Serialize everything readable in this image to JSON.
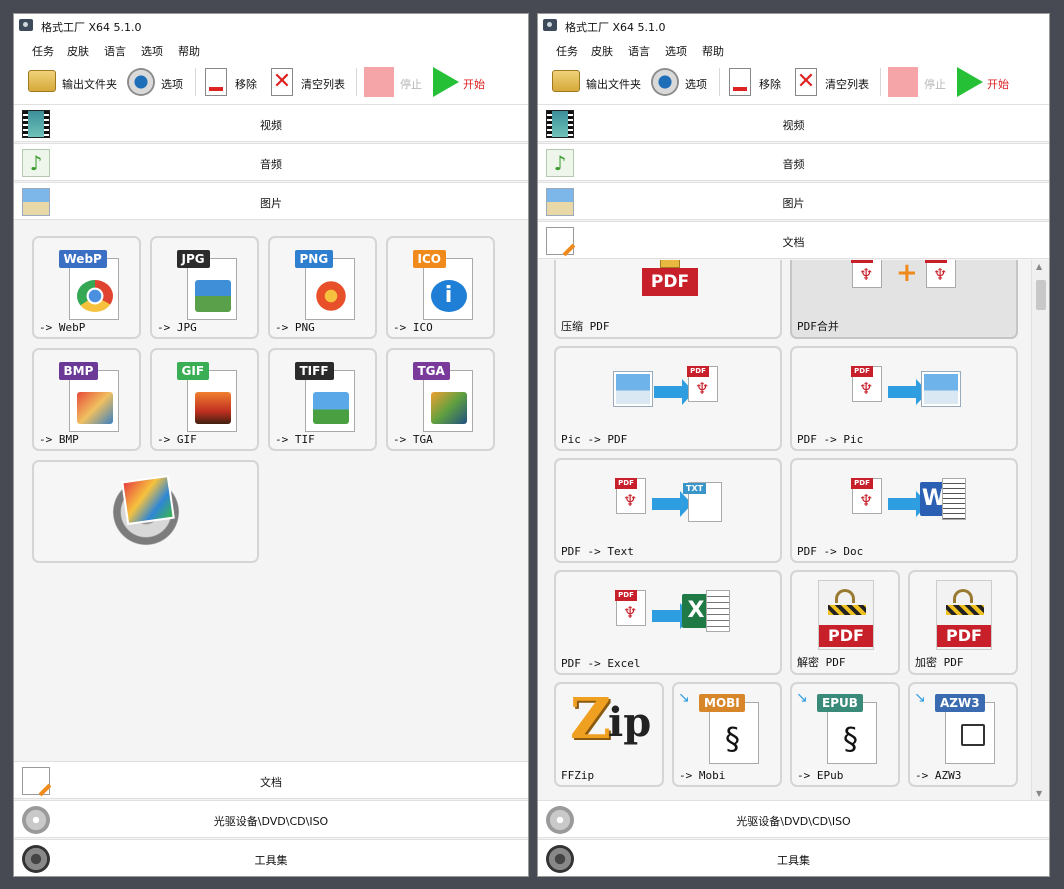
{
  "app": {
    "title": "格式工厂 X64 5.1.0"
  },
  "menu": [
    "任务",
    "皮肤",
    "语言",
    "选项",
    "帮助"
  ],
  "toolbar": {
    "output_folder": "输出文件夹",
    "options": "选项",
    "remove": "移除",
    "clear_list": "清空列表",
    "stop": "停止",
    "start": "开始"
  },
  "categories": {
    "video": "视频",
    "audio": "音频",
    "image": "图片",
    "document": "文档",
    "disc": "光驱设备\\DVD\\CD\\ISO",
    "tools": "工具集"
  },
  "image_formats": [
    {
      "tag": "WebP",
      "label": "-> WebP",
      "color": "#3b6fc4"
    },
    {
      "tag": "JPG",
      "label": "-> JPG",
      "color": "#2b2b2b"
    },
    {
      "tag": "PNG",
      "label": "-> PNG",
      "color": "#2f7fd0"
    },
    {
      "tag": "ICO",
      "label": "-> ICO",
      "color": "#f08a1c"
    },
    {
      "tag": "BMP",
      "label": "-> BMP",
      "color": "#6a3a96"
    },
    {
      "tag": "GIF",
      "label": "-> GIF",
      "color": "#3aae55"
    },
    {
      "tag": "TIFF",
      "label": "-> TIF",
      "color": "#2b2b2b"
    },
    {
      "tag": "TGA",
      "label": "-> TGA",
      "color": "#7a3a9a"
    }
  ],
  "doc_tools": [
    {
      "label": "压缩 PDF"
    },
    {
      "label": "PDF合并"
    },
    {
      "label": "Pic -> PDF"
    },
    {
      "label": "PDF -> Pic"
    },
    {
      "label": "PDF -> Text"
    },
    {
      "label": "PDF -> Doc"
    },
    {
      "label": "PDF -> Excel"
    },
    {
      "label": "解密 PDF"
    },
    {
      "label": "加密 PDF"
    },
    {
      "label": "FFZip"
    },
    {
      "label": "-> Mobi"
    },
    {
      "label": "-> EPub"
    },
    {
      "label": "-> AZW3"
    }
  ],
  "icon_text": {
    "pdf": "PDF",
    "txt": "TXT",
    "word": "W",
    "excel": "X",
    "mobi": "MOBI",
    "epub": "EPUB",
    "azw3": "AZW3",
    "zip_z": "Z",
    "zip_ip": "ip"
  }
}
